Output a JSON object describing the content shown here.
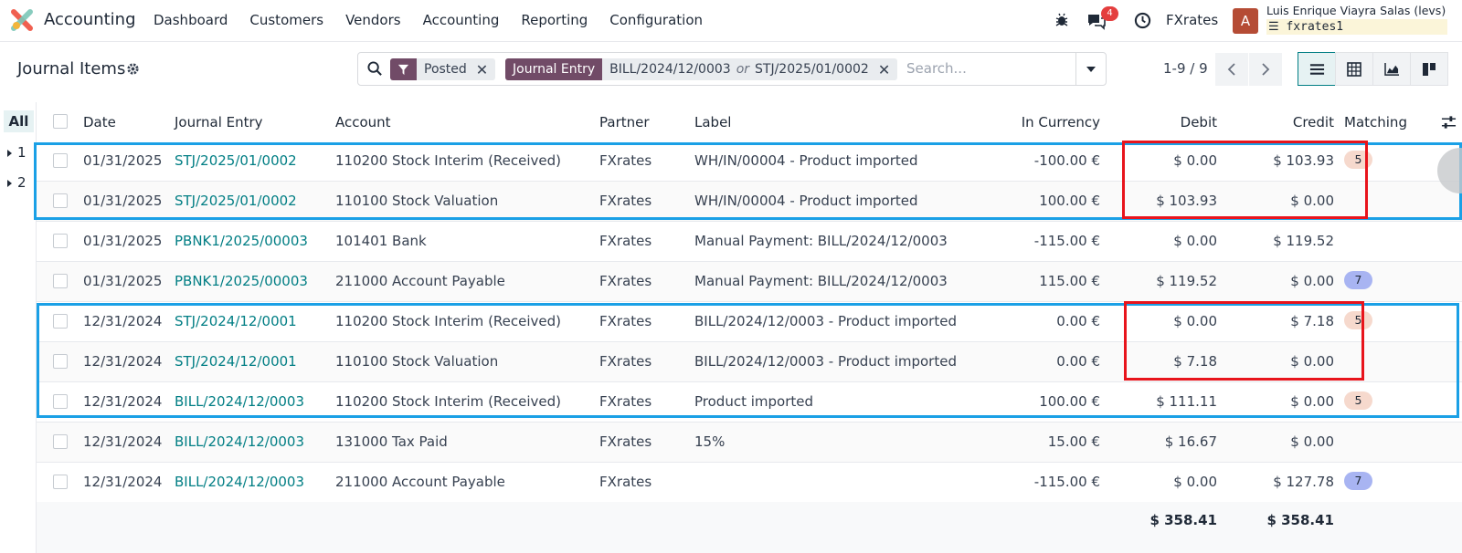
{
  "navbar": {
    "app_name": "Accounting",
    "menu": [
      "Dashboard",
      "Customers",
      "Vendors",
      "Accounting",
      "Reporting",
      "Configuration"
    ],
    "messages_count": "4",
    "company": "FXrates",
    "avatar_letter": "A",
    "user_name": "Luis Enrique Viayra Salas (levs)",
    "database": "fxrates1",
    "icons": [
      "bug-icon",
      "chat-icon",
      "clock-icon"
    ]
  },
  "control": {
    "title": "Journal Items",
    "facets": {
      "posted": "Posted",
      "journal_entry_label": "Journal Entry",
      "journal_value_1": "BILL/2024/12/0003",
      "or_word": "or",
      "journal_value_2": "STJ/2025/01/0002"
    },
    "search_placeholder": "Search...",
    "pager": "1-9 / 9"
  },
  "groups": {
    "all": "All",
    "g1": "1",
    "g2": "2"
  },
  "table": {
    "headers": {
      "date": "Date",
      "journal_entry": "Journal Entry",
      "account": "Account",
      "partner": "Partner",
      "label": "Label",
      "in_currency": "In Currency",
      "debit": "Debit",
      "credit": "Credit",
      "matching": "Matching"
    },
    "rows": [
      {
        "date": "01/31/2025",
        "entry": "STJ/2025/01/0002",
        "account": "110200 Stock Interim (Received)",
        "partner": "FXrates",
        "label": "WH/IN/00004 - Product imported",
        "currency": "-100.00 €",
        "debit": "$ 0.00",
        "credit": "$ 103.93",
        "matching": "5"
      },
      {
        "date": "01/31/2025",
        "entry": "STJ/2025/01/0002",
        "account": "110100 Stock Valuation",
        "partner": "FXrates",
        "label": "WH/IN/00004 - Product imported",
        "currency": "100.00 €",
        "debit": "$ 103.93",
        "credit": "$ 0.00",
        "matching": ""
      },
      {
        "date": "01/31/2025",
        "entry": "PBNK1/2025/00003",
        "account": "101401 Bank",
        "partner": "FXrates",
        "label": "Manual Payment: BILL/2024/12/0003",
        "currency": "-115.00 €",
        "debit": "$ 0.00",
        "credit": "$ 119.52",
        "matching": ""
      },
      {
        "date": "01/31/2025",
        "entry": "PBNK1/2025/00003",
        "account": "211000 Account Payable",
        "partner": "FXrates",
        "label": "Manual Payment: BILL/2024/12/0003",
        "currency": "115.00 €",
        "debit": "$ 119.52",
        "credit": "$ 0.00",
        "matching": "7"
      },
      {
        "date": "12/31/2024",
        "entry": "STJ/2024/12/0001",
        "account": "110200 Stock Interim (Received)",
        "partner": "FXrates",
        "label": "BILL/2024/12/0003 - Product imported",
        "currency": "0.00 €",
        "debit": "$ 0.00",
        "credit": "$ 7.18",
        "matching": "5"
      },
      {
        "date": "12/31/2024",
        "entry": "STJ/2024/12/0001",
        "account": "110100 Stock Valuation",
        "partner": "FXrates",
        "label": "BILL/2024/12/0003 - Product imported",
        "currency": "0.00 €",
        "debit": "$ 7.18",
        "credit": "$ 0.00",
        "matching": ""
      },
      {
        "date": "12/31/2024",
        "entry": "BILL/2024/12/0003",
        "account": "110200 Stock Interim (Received)",
        "partner": "FXrates",
        "label": "Product imported",
        "currency": "100.00 €",
        "debit": "$ 111.11",
        "credit": "$ 0.00",
        "matching": "5"
      },
      {
        "date": "12/31/2024",
        "entry": "BILL/2024/12/0003",
        "account": "131000 Tax Paid",
        "partner": "FXrates",
        "label": "15%",
        "currency": "15.00 €",
        "debit": "$ 16.67",
        "credit": "$ 0.00",
        "matching": ""
      },
      {
        "date": "12/31/2024",
        "entry": "BILL/2024/12/0003",
        "account": "211000 Account Payable",
        "partner": "FXrates",
        "label": "",
        "currency": "-115.00 €",
        "debit": "$ 0.00",
        "credit": "$ 127.78",
        "matching": "7"
      }
    ],
    "totals": {
      "debit": "$ 358.41",
      "credit": "$ 358.41"
    }
  },
  "colors": {
    "brand": "#714b67",
    "link": "#017e84",
    "matching_5": "#f6d9cd",
    "matching_7": "#a8b4f2",
    "annotation_blue": "#1aa0e6",
    "annotation_red": "#e8141c"
  }
}
